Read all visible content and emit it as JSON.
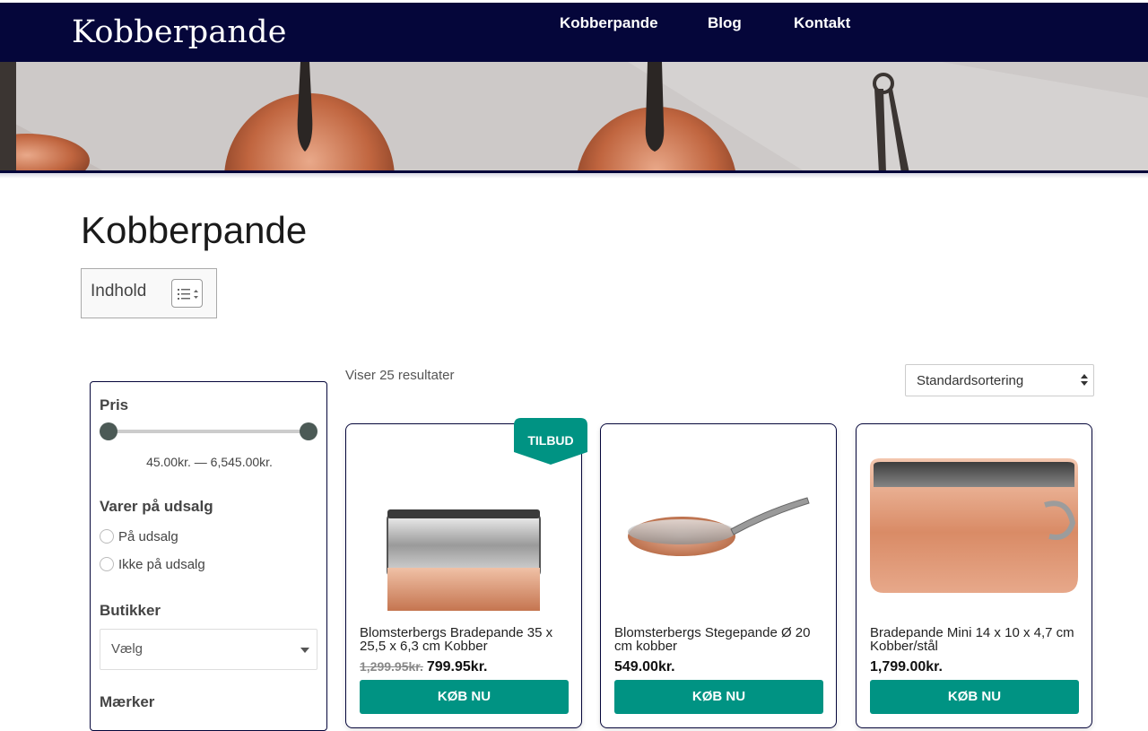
{
  "site": {
    "logo": "Kobberpande"
  },
  "nav": {
    "items": [
      "Kobberpande",
      "Blog",
      "Kontakt"
    ]
  },
  "page": {
    "title": "Kobberpande"
  },
  "toc": {
    "title": "Indhold"
  },
  "filters": {
    "price": {
      "title": "Pris",
      "range_text": "45.00kr. — 6,545.00kr.",
      "min": 45.0,
      "max": 6545.0
    },
    "sale": {
      "title": "Varer på udsalg",
      "options": [
        "På udsalg",
        "Ikke på udsalg"
      ]
    },
    "shops": {
      "title": "Butikker",
      "selected": "Vælg"
    },
    "brands": {
      "title": "Mærker"
    }
  },
  "listing": {
    "results_text": "Viser 25 resultater",
    "sort_selected": "Standardsortering"
  },
  "products": [
    {
      "title": "Blomsterbergs Bradepande 35 x 25,5 x 6,3 cm Kobber",
      "old_price": "1,299.95kr.",
      "price": "799.95kr.",
      "badge": "TILBUD",
      "button": "KØB NU"
    },
    {
      "title": "Blomsterbergs Stegepande Ø 20 cm kobber",
      "price": "549.00kr.",
      "button": "KØB NU"
    },
    {
      "title": "Bradepande Mini 14 x 10 x 4,7 cm Kobber/stål",
      "price": "1,799.00kr.",
      "button": "KØB NU"
    }
  ],
  "colors": {
    "header": "#05063a",
    "accent": "#009383",
    "slider": "#4c5a56"
  },
  "icons": {
    "toc_toggle": "list-toggle-icon",
    "select_arrow": "chevron-down-icon"
  }
}
